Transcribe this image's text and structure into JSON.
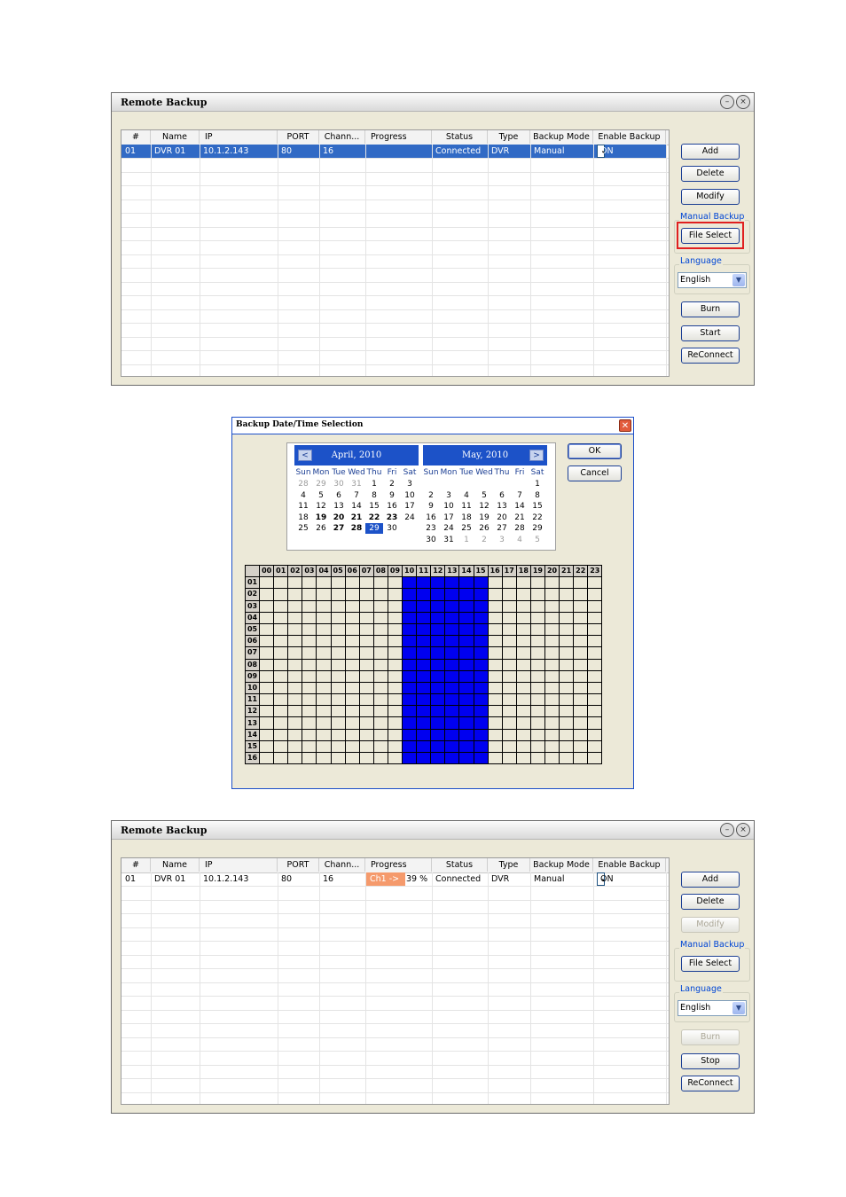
{
  "window1": {
    "title": "Remote Backup",
    "columns": [
      "#",
      "Name",
      "IP",
      "PORT",
      "Chann...",
      "Progress",
      "Status",
      "Type",
      "Backup Mode",
      "Enable Backup"
    ],
    "row": {
      "num": "01",
      "name": "DVR 01",
      "ip": "10.1.2.143",
      "port": "80",
      "channels": "16",
      "progress": "",
      "status": "Connected",
      "type": "DVR",
      "mode": "Manual",
      "enable": "ON"
    },
    "buttons": {
      "add": "Add",
      "delete": "Delete",
      "modify": "Modify",
      "file_select": "File Select",
      "burn": "Burn",
      "start": "Start",
      "reconnect": "ReConnect"
    },
    "manual_backup_label": "Manual Backup",
    "language_label": "Language",
    "language_value": "English"
  },
  "dialog": {
    "title": "Backup Date/Time Selection",
    "ok": "OK",
    "cancel": "Cancel",
    "dow": [
      "Sun",
      "Mon",
      "Tue",
      "Wed",
      "Thu",
      "Fri",
      "Sat"
    ],
    "april": {
      "title": "April, 2010",
      "days": [
        [
          "28",
          "29",
          "30",
          "31",
          "1",
          "2",
          "3"
        ],
        [
          "4",
          "5",
          "6",
          "7",
          "8",
          "9",
          "10"
        ],
        [
          "11",
          "12",
          "13",
          "14",
          "15",
          "16",
          "17"
        ],
        [
          "18",
          "19",
          "20",
          "21",
          "22",
          "23",
          "24"
        ],
        [
          "25",
          "26",
          "27",
          "28",
          "29",
          "30",
          ""
        ]
      ]
    },
    "may": {
      "title": "May, 2010",
      "days": [
        [
          "",
          "",
          "",
          "",
          "",
          "",
          "1"
        ],
        [
          "2",
          "3",
          "4",
          "5",
          "6",
          "7",
          "8"
        ],
        [
          "9",
          "10",
          "11",
          "12",
          "13",
          "14",
          "15"
        ],
        [
          "16",
          "17",
          "18",
          "19",
          "20",
          "21",
          "22"
        ],
        [
          "23",
          "24",
          "25",
          "26",
          "27",
          "28",
          "29"
        ],
        [
          "30",
          "31",
          "1",
          "2",
          "3",
          "4",
          "5"
        ]
      ]
    },
    "hours": [
      "00",
      "01",
      "02",
      "03",
      "04",
      "05",
      "06",
      "07",
      "08",
      "09",
      "10",
      "11",
      "12",
      "13",
      "14",
      "15",
      "16",
      "17",
      "18",
      "19",
      "20",
      "21",
      "22",
      "23"
    ],
    "channels": [
      "01",
      "02",
      "03",
      "04",
      "05",
      "06",
      "07",
      "08",
      "09",
      "10",
      "11",
      "12",
      "13",
      "14",
      "15",
      "16"
    ],
    "selected_hours": [
      "10",
      "11",
      "12",
      "13",
      "14",
      "15"
    ]
  },
  "window2": {
    "title": "Remote Backup",
    "columns": [
      "#",
      "Name",
      "IP",
      "PORT",
      "Chann...",
      "Progress",
      "Status",
      "Type",
      "Backup Mode",
      "Enable Backup"
    ],
    "row": {
      "num": "01",
      "name": "DVR 01",
      "ip": "10.1.2.143",
      "port": "80",
      "channels": "16",
      "progress_label": "Ch1 -> ",
      "progress_pct": "39 %",
      "progress_value": 0.39,
      "status": "Connected",
      "type": "DVR",
      "mode": "Manual",
      "enable": "ON"
    },
    "buttons": {
      "add": "Add",
      "delete": "Delete",
      "modify": "Modify",
      "file_select": "File Select",
      "burn": "Burn",
      "stop": "Stop",
      "reconnect": "ReConnect"
    },
    "manual_backup_label": "Manual Backup",
    "language_label": "Language",
    "language_value": "English"
  },
  "colors": {
    "selection": "#316ac5",
    "grid_selected": "#0000f0",
    "highlight": "#e02020",
    "progress": "#f59a6c"
  }
}
